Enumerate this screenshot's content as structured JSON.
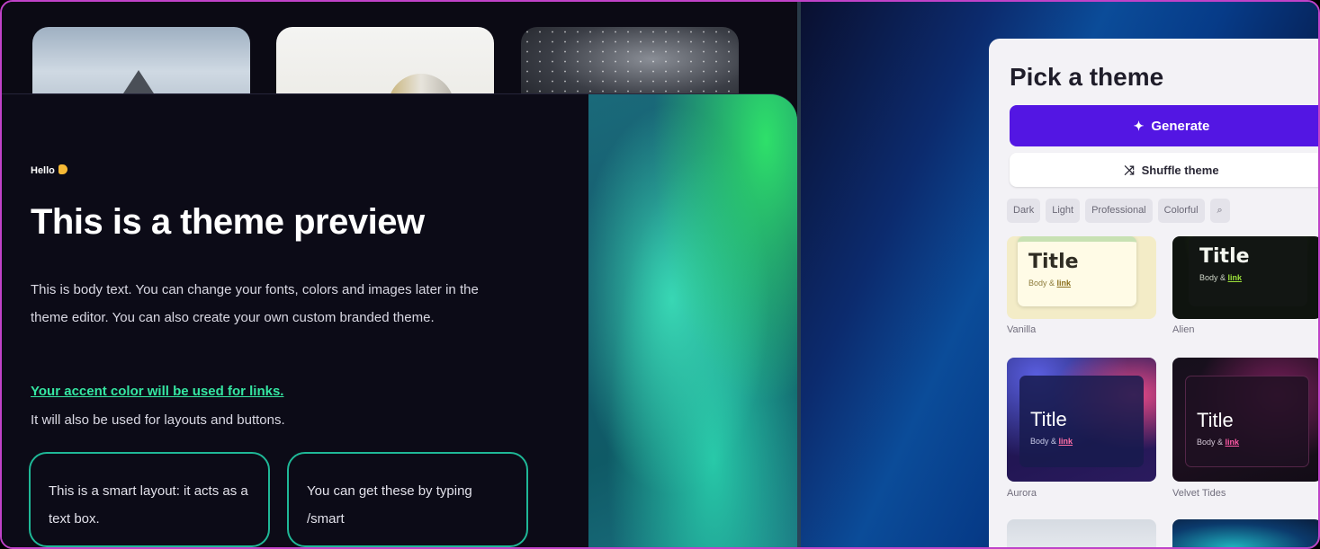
{
  "preview": {
    "hello": "Hello",
    "title": "This is a theme preview",
    "body": "This is body text. You can change your fonts, colors and images later in the theme editor. You can also create your own custom branded theme.",
    "link": "Your accent color will be used for links.",
    "subtext": "It will also be used for layouts and buttons.",
    "smart_box_1": "This is a smart layout: it acts as a text box.",
    "smart_box_2": "You can get these by typing /smart"
  },
  "panel": {
    "title": "Pick a theme",
    "generate_label": "Generate",
    "shuffle_label": "Shuffle theme",
    "filters": [
      "Dark",
      "Light",
      "Professional",
      "Colorful"
    ],
    "themes": [
      {
        "name": "Vanilla",
        "preview_title": "Title",
        "preview_body": "Body &",
        "preview_link": "link"
      },
      {
        "name": "Alien",
        "preview_title": "Title",
        "preview_body": "Body &",
        "preview_link": "link"
      },
      {
        "name": "Aurora",
        "preview_title": "Title",
        "preview_body": "Body &",
        "preview_link": "link"
      },
      {
        "name": "Velvet Tides",
        "preview_title": "Title",
        "preview_body": "Body &",
        "preview_link": "link"
      }
    ]
  },
  "icons": {
    "hello": "waving-hand-icon",
    "generate": "sparkle-icon",
    "shuffle": "shuffle-icon",
    "search": "search-icon"
  },
  "colors": {
    "accent_link": "#35e6a2",
    "generate_button": "#5316e3",
    "frame_border": "#c042c8"
  }
}
